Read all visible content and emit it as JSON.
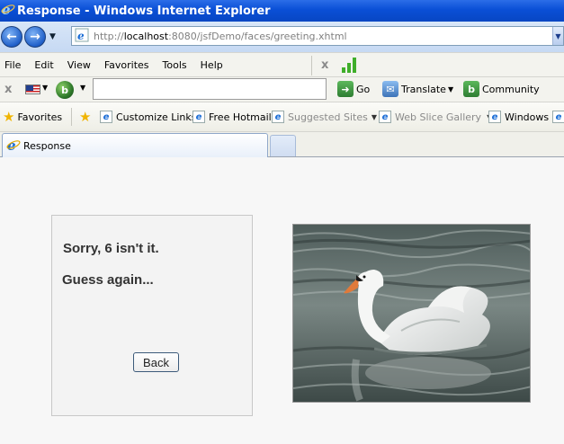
{
  "window": {
    "title": "Response - Windows Internet Explorer"
  },
  "address_bar": {
    "url_prefix": "http://",
    "url_host": "localhost",
    "url_rest": ":8080/jsfDemo/faces/greeting.xhtml"
  },
  "menu": {
    "items": [
      "File",
      "Edit",
      "View",
      "Favorites",
      "Tools",
      "Help"
    ]
  },
  "toolbar": {
    "go_label": "Go",
    "translate_label": "Translate",
    "community_label": "Community"
  },
  "favorites_bar": {
    "favorites_label": "Favorites",
    "items": [
      {
        "label": "Customize Links"
      },
      {
        "label": "Free Hotmail"
      },
      {
        "label": "Suggested Sites"
      },
      {
        "label": "Web Slice Gallery"
      },
      {
        "label": "Windows"
      }
    ]
  },
  "tabs": {
    "active_label": "Response"
  },
  "page": {
    "message_line1": "Sorry, 6 isn't it.",
    "message_line2": "Guess again...",
    "back_button_label": "Back"
  }
}
